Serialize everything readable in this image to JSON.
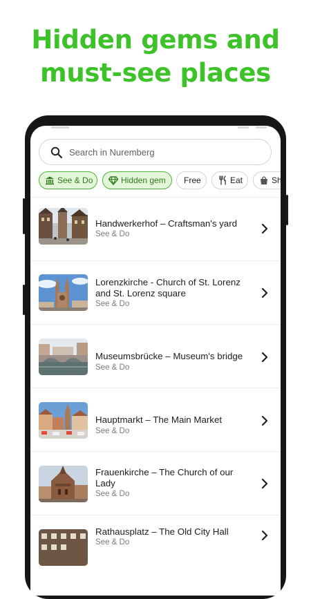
{
  "headline": {
    "line1": "Hidden gems and",
    "line2": "must-see places",
    "color": "#3ec22a"
  },
  "search": {
    "placeholder": "Search in Nuremberg",
    "icon": "search-icon"
  },
  "chips": [
    {
      "label": "See & Do",
      "icon": "museum-icon",
      "active": true
    },
    {
      "label": "Hidden gem",
      "icon": "diamond-icon",
      "active": true
    },
    {
      "label": "Free",
      "icon": null,
      "active": false
    },
    {
      "label": "Eat",
      "icon": "cutlery-icon",
      "active": false
    },
    {
      "label": "Sh",
      "icon": "shopping-bag-icon",
      "active": false
    }
  ],
  "places": [
    {
      "title": "Handwerkerhof – Craftsman's yard",
      "category": "See & Do"
    },
    {
      "title": "Lorenzkirche - Church of St. Lorenz and St. Lorenz square",
      "category": "See & Do"
    },
    {
      "title": "Museumsbrücke – Museum's bridge",
      "category": "See & Do"
    },
    {
      "title": "Hauptmarkt – The Main Market",
      "category": "See & Do"
    },
    {
      "title": "Frauenkirche – The Church of our Lady",
      "category": "See & Do"
    },
    {
      "title": "Rathausplatz – The Old City Hall",
      "category": "See & Do"
    }
  ],
  "colors": {
    "accent": "#3ec22a",
    "chip_active_bg": "#e3f6da",
    "chip_active_border": "#4fb231"
  }
}
